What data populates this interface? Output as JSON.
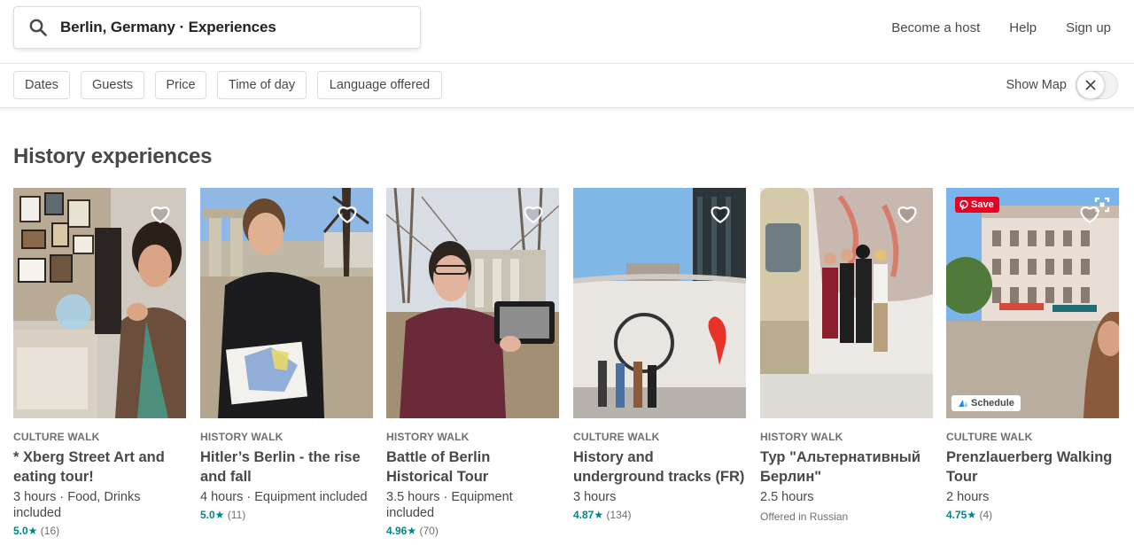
{
  "search": {
    "value": "Berlin, Germany · Experiences",
    "icon": "search-icon"
  },
  "nav": {
    "become_host": "Become a host",
    "help": "Help",
    "sign_up": "Sign up"
  },
  "filters": {
    "dates": "Dates",
    "guests": "Guests",
    "price": "Price",
    "time_of_day": "Time of day",
    "language": "Language offered",
    "show_map": "Show Map",
    "toggle_icon": "close-icon"
  },
  "section": {
    "title": "History experiences"
  },
  "cards": [
    {
      "kind": "CULTURE WALK",
      "title": "* Xberg Street Art and eating tour!",
      "meta": "3 hours · Food, Drinks included",
      "score": "5.0★",
      "count": "(16)"
    },
    {
      "kind": "HISTORY WALK",
      "title": "Hitler’s Berlin - the rise and fall",
      "meta": "4 hours · Equipment included",
      "score": "5.0★",
      "count": "(11)"
    },
    {
      "kind": "HISTORY WALK",
      "title": "Battle of Berlin Historical Tour",
      "meta": "3.5 hours · Equipment included",
      "score": "4.96★",
      "count": "(70)"
    },
    {
      "kind": "CULTURE WALK",
      "title": "History and underground tracks (FR)",
      "meta": "3 hours",
      "score": "4.87★",
      "count": "(134)"
    },
    {
      "kind": "HISTORY WALK",
      "title": "Тур \"Альтернативный Берлин\"",
      "meta": "2.5 hours",
      "offered": "Offered in Russian"
    },
    {
      "kind": "CULTURE WALK",
      "title": "Prenzlauerberg Walking Tour",
      "meta": "2 hours",
      "score": "4.75★",
      "count": "(4)",
      "pin_save": "Save",
      "schedule": "Schedule"
    }
  ],
  "colors": {
    "accent_teal": "#008489",
    "pinterest_red": "#e60023",
    "text": "#484848"
  }
}
